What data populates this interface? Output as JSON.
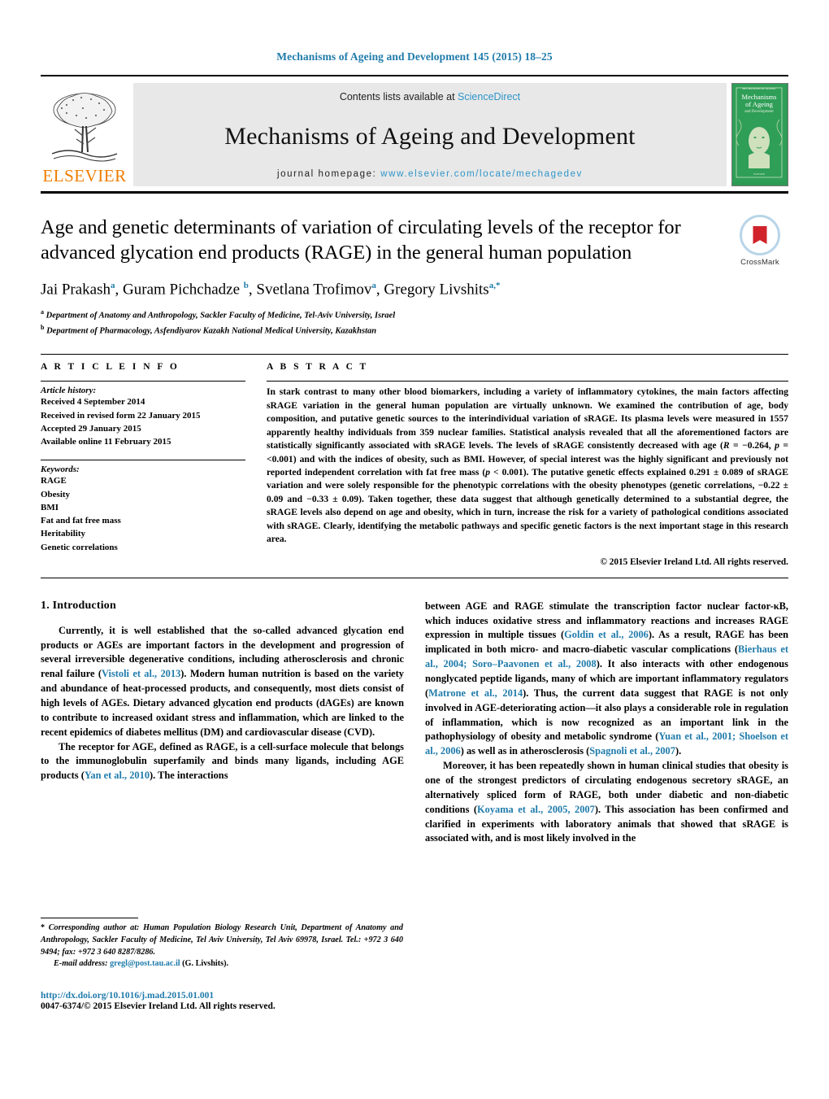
{
  "running_head": "Mechanisms of Ageing and Development 145 (2015) 18–25",
  "masthead": {
    "publisher_name": "ELSEVIER",
    "contents_prefix": "Contents lists available at ",
    "contents_link": "ScienceDirect",
    "journal_name": "Mechanisms of Ageing and Development",
    "homepage_prefix": "journal homepage: ",
    "homepage_url": "www.elsevier.com/locate/mechagedev",
    "cover_title_line1": "Mechanisms",
    "cover_title_line2": "of Ageing",
    "cover_title_line3": "and Development"
  },
  "article": {
    "title": "Age and genetic determinants of variation of circulating levels of the receptor for advanced glycation end products (RAGE) in the general human population",
    "authors_html": "Jai Prakash<sup>a</sup>, Guram Pichchadze <sup>b</sup>, Svetlana Trofimov<sup>a</sup>, Gregory Livshits<sup>a,*</sup>",
    "affiliations": [
      {
        "marker": "a",
        "text": "Department of Anatomy and Anthropology, Sackler Faculty of Medicine, Tel-Aviv University, Israel"
      },
      {
        "marker": "b",
        "text": "Department of Pharmacology, Asfendiyarov Kazakh National Medical University, Kazakhstan"
      }
    ],
    "crossmark_label": "CrossMark"
  },
  "article_info": {
    "heading": "A R T I C L E   I N F O",
    "history_label": "Article history:",
    "history": [
      "Received 4 September 2014",
      "Received in revised form 22 January 2015",
      "Accepted 29 January 2015",
      "Available online 11 February 2015"
    ],
    "keywords_label": "Keywords:",
    "keywords": [
      "RAGE",
      "Obesity",
      "BMI",
      "Fat and fat free mass",
      "Heritability",
      "Genetic correlations"
    ]
  },
  "abstract": {
    "heading": "A B S T R A C T",
    "text_html": "In stark contrast to many other blood biomarkers, including a variety of inflammatory cytokines, the main factors affecting sRAGE variation in the general human population are virtually unknown. We examined the contribution of age, body composition, and putative genetic sources to the interindividual variation of sRAGE. Its plasma levels were measured in 1557 apparently healthy individuals from 359 nuclear families. Statistical analysis revealed that all the aforementioned factors are statistically significantly associated with sRAGE levels. The levels of sRAGE consistently decreased with age (<i>R</i> = −0.264, <i>p</i> = &lt;0.001) and with the indices of obesity, such as BMI. However, of special interest was the highly significant and previously not reported independent correlation with fat free mass (<i>p</i> &lt; 0.001). The putative genetic effects explained 0.291 ± 0.089 of sRAGE variation and were solely responsible for the phenotypic correlations with the obesity phenotypes (genetic correlations, −0.22 ± 0.09 and −0.33 ± 0.09). Taken together, these data suggest that although genetically determined to a substantial degree, the sRAGE levels also depend on age and obesity, which in turn, increase the risk for a variety of pathological conditions associated with sRAGE. Clearly, identifying the metabolic pathways and specific genetic factors is the next important stage in this research area.",
    "copyright": "© 2015 Elsevier Ireland Ltd. All rights reserved."
  },
  "body": {
    "section_title": "1.  Introduction",
    "left_paragraphs_html": [
      "Currently, it is well established that the so-called advanced glycation end products or AGEs are important factors in the development and progression of several irreversible degenerative conditions, including atherosclerosis and chronic renal failure (<span class=\"ref\">Vistoli et al., 2013</span>). Modern human nutrition is based on the variety and abundance of heat-processed products, and consequently, most diets consist of high levels of AGEs. Dietary advanced glycation end products (dAGEs) are known to contribute to increased oxidant stress and inflammation, which are linked to the recent epidemics of diabetes mellitus (DM) and cardiovascular disease (CVD).",
      "The receptor for AGE, defined as RAGE, is a cell-surface molecule that belongs to the immunoglobulin superfamily and binds many ligands, including AGE products (<span class=\"ref\">Yan et al., 2010</span>). The interactions"
    ],
    "right_paragraphs_html": [
      "between AGE and RAGE stimulate the transcription factor nuclear factor-κB, which induces oxidative stress and inflammatory reactions and increases RAGE expression in multiple tissues (<span class=\"ref\">Goldin et al., 2006</span>). As a result, RAGE has been implicated in both micro- and macro-diabetic vascular complications (<span class=\"ref\">Bierhaus et al., 2004; Soro–Paavonen et al., 2008</span>). It also interacts with other endogenous nonglycated peptide ligands, many of which are important inflammatory regulators (<span class=\"ref\">Matrone et al., 2014</span>). Thus, the current data suggest that RAGE is not only involved in AGE-deteriorating action—it also plays a considerable role in regulation of inflammation, which is now recognized as an important link in the pathophysiology of obesity and metabolic syndrome (<span class=\"ref\">Yuan et al., 2001; Shoelson et al., 2006</span>) as well as in atherosclerosis (<span class=\"ref\">Spagnoli et al., 2007</span>).",
      "Moreover, it has been repeatedly shown in human clinical studies that obesity is one of the strongest predictors of circulating endogenous secretory sRAGE, an alternatively spliced form of RAGE, both under diabetic and non-diabetic conditions (<span class=\"ref\">Koyama et al., 2005, 2007</span>). This association has been confirmed and clarified in experiments with laboratory animals that showed that sRAGE is associated with, and is most likely involved in the"
    ]
  },
  "footer": {
    "corresponding_html": "* <span class=\"em\">Corresponding author at: Human Population Biology Research Unit, Department of Anatomy and Anthropology, Sackler Faculty of Medicine, Tel Aviv University, Tel Aviv 69978, Israel. Tel.: +972 3 640 9494; fax: +972 3 640 8287/8286.</span>",
    "email_html": "<span class=\"em\">E-mail address:</span> <span class=\"link\">gregl@post.tau.ac.il</span> (G. Livshits).",
    "doi": "http://dx.doi.org/10.1016/j.mad.2015.01.001",
    "issn_line": "0047-6374/© 2015 Elsevier Ireland Ltd. All rights reserved."
  }
}
